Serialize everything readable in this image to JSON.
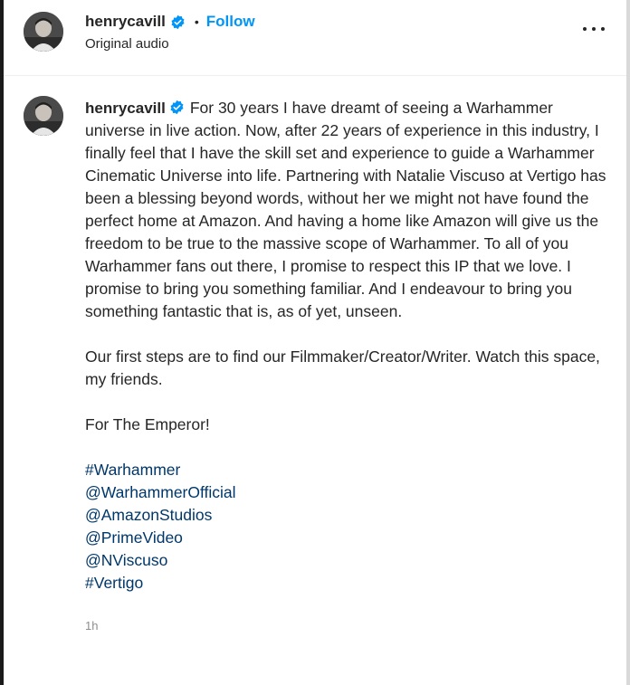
{
  "header": {
    "username": "henrycavill",
    "separator": "•",
    "follow_label": "Follow",
    "subtitle": "Original audio"
  },
  "post": {
    "username": "henrycavill",
    "paragraph_1": "For 30 years I have dreamt of seeing a Warhammer universe in live action. Now, after 22 years of experience in this industry, I finally feel that I have the skill set and experience to guide a Warhammer Cinematic Universe into life. Partnering with Natalie Viscuso at Vertigo has been a blessing beyond words, without her we might not have found the perfect home at Amazon. And having a home like Amazon will give us the freedom to be true to the massive scope of Warhammer. To all of you Warhammer fans out there, I promise to respect this IP that we love. I promise to bring you something familiar. And I endeavour to bring you something fantastic that is, as of yet, unseen.",
    "paragraph_2": "Our first steps are to find our Filmmaker/Creator/Writer. Watch this space, my friends.",
    "paragraph_3": "For The Emperor!",
    "tags": [
      "#Warhammer",
      "@WarhammerOfficial",
      "@AmazonStudios",
      "@PrimeVideo",
      "@NViscuso",
      "#Vertigo"
    ],
    "time": "1h"
  },
  "icons": {
    "verified": "verified-badge-icon",
    "more": "more-options-icon"
  },
  "colors": {
    "link": "#0095f6",
    "tag": "#00376b",
    "verified": "#0095f6"
  }
}
